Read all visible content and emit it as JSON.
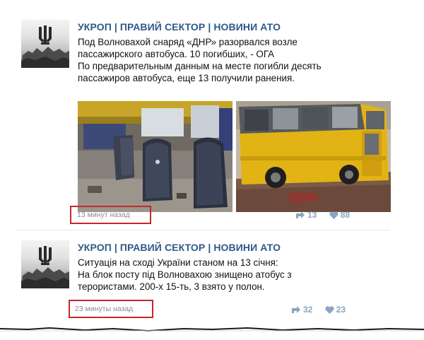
{
  "colors": {
    "author": "#2f5a87",
    "text": "#111111",
    "meta": "#8a8a8a",
    "stats": "#8aa4c1",
    "highlight_box": "#c8262b",
    "bus_yellow": "#e2b314"
  },
  "posts": [
    {
      "author": "УКРОП | ПРАВИЙ СЕКТОР | НОВИНИ АТО",
      "lines": [
        "Под Волновахой снаряд «ДНР» разорвался возле",
        "пассажирского автобуса. 10 погибших, - ОГА",
        "По предварительным данным на месте погибли десять",
        "пассажиров автобуса, еще 13 получили ранения."
      ],
      "timestamp": "13 минут назад",
      "reposts": "13",
      "likes": "88",
      "icons": [
        "repost-icon",
        "heart-icon"
      ]
    },
    {
      "author": "УКРОП | ПРАВИЙ СЕКТОР | НОВИНИ АТО",
      "lines": [
        "Ситуація на сході України станом на 13 січня:",
        "На блок посту під Волновахою знищено атобус з",
        "терористами. 200-х 15-ть, 3 взято у полон."
      ],
      "timestamp": "23 минуты назад",
      "reposts": "32",
      "likes": "23",
      "icons": [
        "repost-icon",
        "heart-icon"
      ]
    }
  ]
}
